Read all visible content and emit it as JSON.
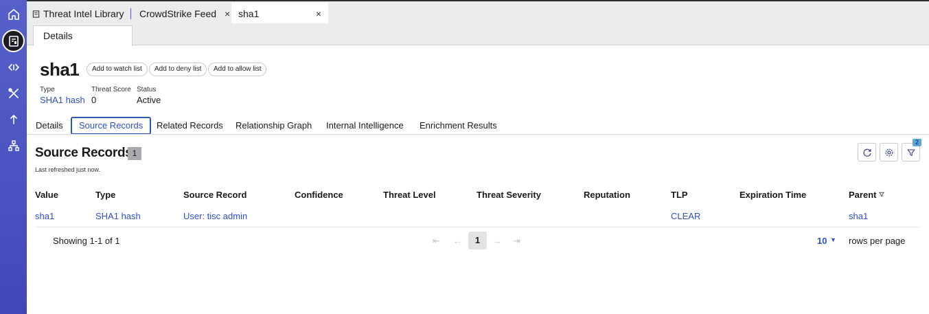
{
  "rail": {
    "items": [
      "home-icon",
      "library-icon",
      "feed-icon",
      "tools-icon",
      "upload-icon",
      "hierarchy-icon"
    ]
  },
  "tabs": [
    {
      "label": "Threat Intel Library",
      "icon": "document-icon"
    },
    {
      "label": "CrowdStrike Feed",
      "close": "×"
    },
    {
      "label": "sha1",
      "close": "×"
    }
  ],
  "subtab": {
    "label": "Details"
  },
  "header": {
    "title": "sha1",
    "actions": [
      "Add to watch list",
      "Add to deny list",
      "Add to allow list"
    ],
    "meta": [
      {
        "label": "Type",
        "value": "SHA1 hash"
      },
      {
        "label": "Threat Score",
        "value": "0"
      },
      {
        "label": "Status",
        "value": "Active"
      }
    ]
  },
  "section_tabs": [
    "Details",
    "Source Records",
    "Related Records",
    "Relationship Graph",
    "Internal Intelligence",
    "Enrichment Results"
  ],
  "active_section_tab": "Source Records",
  "source_records": {
    "title": "Source Records",
    "count": "1",
    "subtitle": "Last refreshed just now.",
    "filter_badge": "2",
    "columns": [
      "Value",
      "Type",
      "Source Record",
      "Confidence",
      "Threat Level",
      "Threat Severity",
      "Reputation",
      "TLP",
      "Expiration Time",
      "Parent"
    ],
    "rows": [
      {
        "value": "sha1",
        "type": "SHA1 hash",
        "source_record": "User: tisc admin",
        "confidence": "",
        "threat_level": "",
        "threat_severity": "",
        "reputation": "",
        "tlp": "CLEAR",
        "expiration_time": "",
        "parent": "sha1"
      }
    ]
  },
  "pagination": {
    "showing": "Showing 1-1 of 1",
    "current_page": "1",
    "rows_per_page_value": "10",
    "rows_per_page_label": "rows per page"
  },
  "colors": {
    "accent": "#2e4fc7",
    "rail": "#4a53c0"
  }
}
